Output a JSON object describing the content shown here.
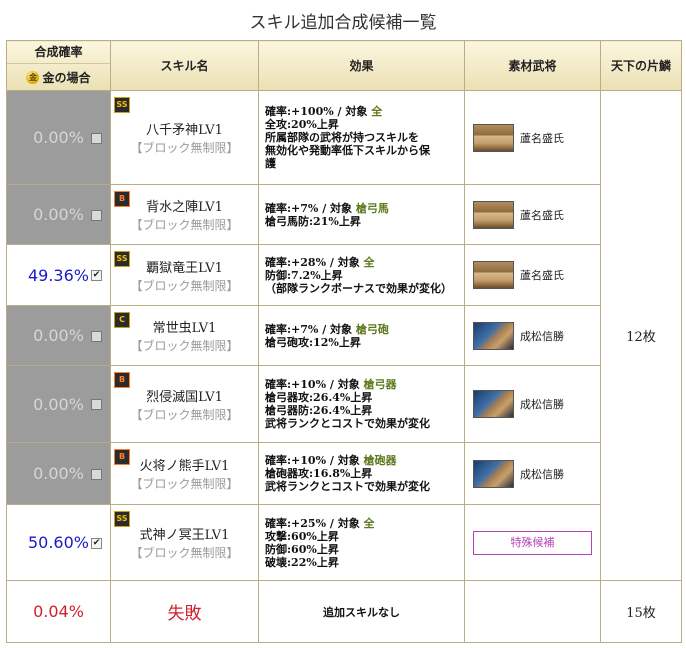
{
  "title": "スキル追加合成候補一覧",
  "headers": {
    "rate": "合成確率",
    "gold_case": "金の場合",
    "coin_icon": "金",
    "skill_name": "スキル名",
    "effect": "効果",
    "material": "素材武将",
    "tenka": "天下の片鱗"
  },
  "rows": [
    {
      "rate": "0.00%",
      "checked": "",
      "badge": "SS",
      "name": "八千矛神LV1",
      "sub": "【ブロック無制限】",
      "effect": [
        "確率:+100% / 対象 ",
        "全",
        "全攻:20%上昇",
        "所属部隊の武将が持つスキルを",
        "無効化や発動率低下スキルから保",
        "護"
      ],
      "material": "蘆名盛氏"
    },
    {
      "rate": "0.00%",
      "checked": "",
      "badge": "B",
      "name": "背水之陣LV1",
      "sub": "【ブロック無制限】",
      "effect": [
        "確率:+7% / 対象 ",
        "槍弓馬",
        "槍弓馬防:21%上昇"
      ],
      "material": "蘆名盛氏"
    },
    {
      "rate": "49.36%",
      "checked": "✔",
      "badge": "SS",
      "name": "覇獄竜王LV1",
      "sub": "【ブロック無制限】",
      "effect": [
        "確率:+28% / 対象 ",
        "全",
        "防御:7.2%上昇",
        "（部隊ランクボーナスで効果が変化）"
      ],
      "material": "蘆名盛氏"
    },
    {
      "rate": "0.00%",
      "checked": "",
      "badge": "C",
      "name": "常世虫LV1",
      "sub": "【ブロック無制限】",
      "effect": [
        "確率:+7% / 対象 ",
        "槍弓砲",
        "槍弓砲攻:12%上昇"
      ],
      "material": "成松信勝"
    },
    {
      "rate": "0.00%",
      "checked": "",
      "badge": "B",
      "name": "烈侵滅国LV1",
      "sub": "【ブロック無制限】",
      "effect": [
        "確率:+10% / 対象 ",
        "槍弓器",
        "槍弓器攻:26.4%上昇",
        "槍弓器防:26.4%上昇",
        "武将ランクとコストで効果が変化"
      ],
      "material": "成松信勝"
    },
    {
      "rate": "0.00%",
      "checked": "",
      "badge": "B",
      "name": "火将ノ熊手LV1",
      "sub": "【ブロック無制限】",
      "effect": [
        "確率:+10% / 対象 ",
        "槍砲器",
        "槍砲器攻:16.8%上昇",
        "武将ランクとコストで効果が変化"
      ],
      "material": "成松信勝"
    },
    {
      "rate": "50.60%",
      "checked": "✔",
      "badge": "SS",
      "name": "式神ノ冥王LV1",
      "sub": "【ブロック無制限】",
      "effect": [
        "確率:+25% / 対象 ",
        "全",
        "攻撃:60%上昇",
        "防御:60%上昇",
        "破壊:22%上昇"
      ],
      "material": "特殊候補"
    }
  ],
  "tenka_main": "12枚",
  "fail_row": {
    "rate": "0.04%",
    "label": "失敗",
    "effect": "追加スキルなし",
    "tenka": "15枚"
  }
}
